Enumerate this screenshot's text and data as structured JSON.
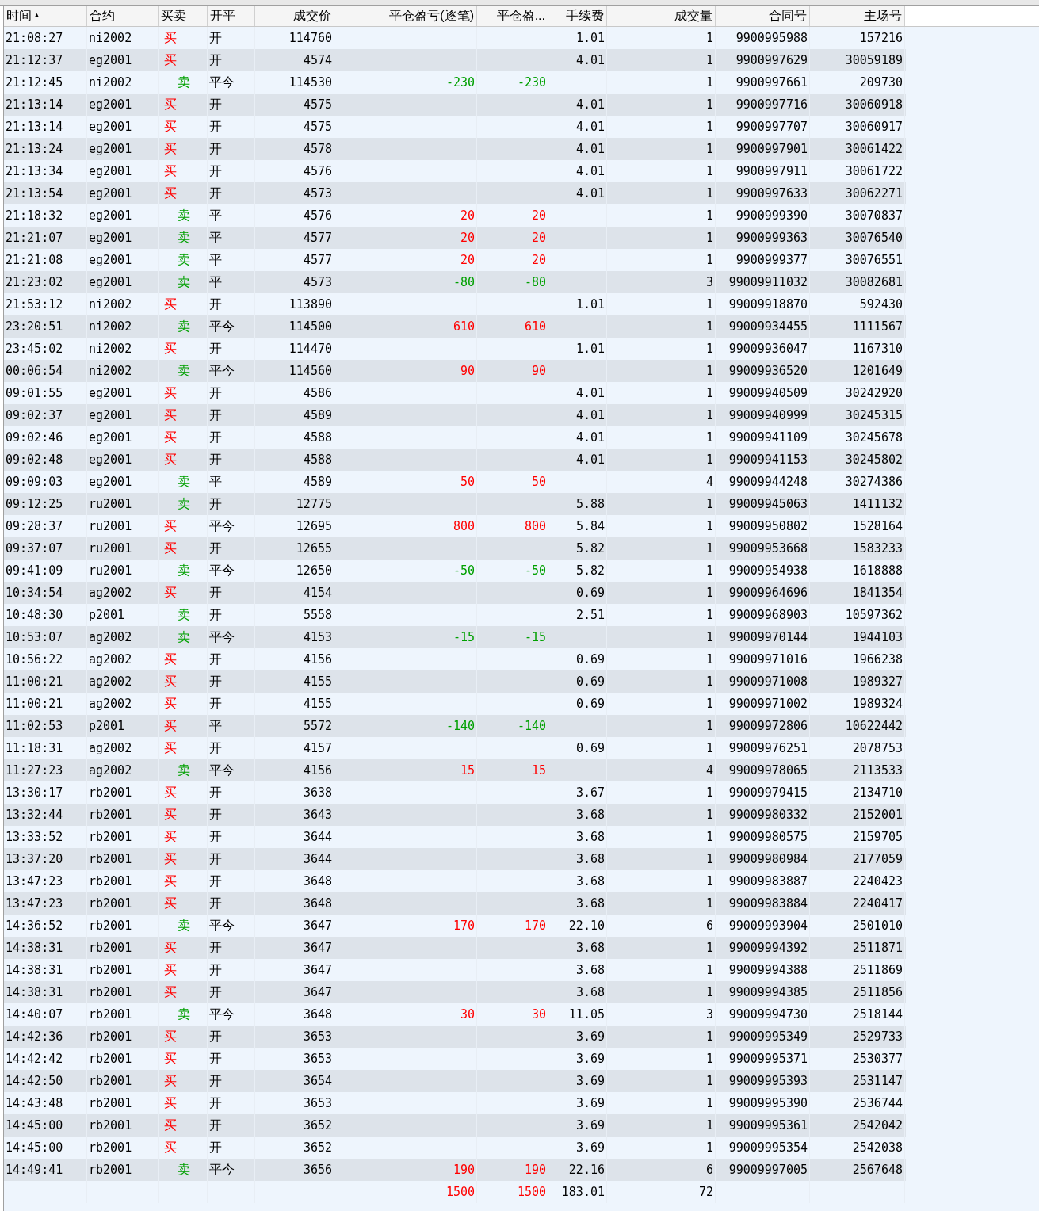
{
  "table": {
    "columns": [
      {
        "label": "时间",
        "sort_indicator": "▲"
      },
      {
        "label": "合约"
      },
      {
        "label": "买卖"
      },
      {
        "label": "开平"
      },
      {
        "label": "成交价"
      },
      {
        "label": "平仓盈亏(逐笔)"
      },
      {
        "label": "平仓盈..."
      },
      {
        "label": "手续费"
      },
      {
        "label": "成交量"
      },
      {
        "label": "合同号"
      },
      {
        "label": "主场号"
      }
    ],
    "rows": [
      {
        "kind": "buy",
        "cells": [
          "21:08:27",
          "ni2002",
          "买",
          "开",
          "114760",
          null,
          null,
          "1.01",
          "1",
          "9900995988",
          "157216"
        ]
      },
      {
        "kind": "buy",
        "cells": [
          "21:12:37",
          "eg2001",
          "买",
          "开",
          "4574",
          null,
          null,
          "4.01",
          "1",
          "9900997629",
          "30059189"
        ]
      },
      {
        "kind": "sell",
        "profit": false,
        "cells": [
          "21:12:45",
          "ni2002",
          "卖",
          "平今",
          "114530",
          "-230",
          "-230",
          null,
          "1",
          "9900997661",
          "209730"
        ]
      },
      {
        "kind": "buy",
        "cells": [
          "21:13:14",
          "eg2001",
          "买",
          "开",
          "4575",
          null,
          null,
          "4.01",
          "1",
          "9900997716",
          "30060918"
        ]
      },
      {
        "kind": "buy",
        "cells": [
          "21:13:14",
          "eg2001",
          "买",
          "开",
          "4575",
          null,
          null,
          "4.01",
          "1",
          "9900997707",
          "30060917"
        ]
      },
      {
        "kind": "buy",
        "cells": [
          "21:13:24",
          "eg2001",
          "买",
          "开",
          "4578",
          null,
          null,
          "4.01",
          "1",
          "9900997901",
          "30061422"
        ]
      },
      {
        "kind": "buy",
        "cells": [
          "21:13:34",
          "eg2001",
          "买",
          "开",
          "4576",
          null,
          null,
          "4.01",
          "1",
          "9900997911",
          "30061722"
        ]
      },
      {
        "kind": "buy",
        "cells": [
          "21:13:54",
          "eg2001",
          "买",
          "开",
          "4573",
          null,
          null,
          "4.01",
          "1",
          "9900997633",
          "30062271"
        ]
      },
      {
        "kind": "sell",
        "profit": true,
        "cells": [
          "21:18:32",
          "eg2001",
          "卖",
          "平",
          "4576",
          "20",
          "20",
          null,
          "1",
          "9900999390",
          "30070837"
        ]
      },
      {
        "kind": "sell",
        "profit": true,
        "cells": [
          "21:21:07",
          "eg2001",
          "卖",
          "平",
          "4577",
          "20",
          "20",
          null,
          "1",
          "9900999363",
          "30076540"
        ]
      },
      {
        "kind": "sell",
        "profit": true,
        "cells": [
          "21:21:08",
          "eg2001",
          "卖",
          "平",
          "4577",
          "20",
          "20",
          null,
          "1",
          "9900999377",
          "30076551"
        ]
      },
      {
        "kind": "sell",
        "profit": false,
        "cells": [
          "21:23:02",
          "eg2001",
          "卖",
          "平",
          "4573",
          "-80",
          "-80",
          null,
          "3",
          "99009911032",
          "30082681"
        ]
      },
      {
        "kind": "buy",
        "cells": [
          "21:53:12",
          "ni2002",
          "买",
          "开",
          "113890",
          null,
          null,
          "1.01",
          "1",
          "99009918870",
          "592430"
        ]
      },
      {
        "kind": "sell",
        "profit": true,
        "cells": [
          "23:20:51",
          "ni2002",
          "卖",
          "平今",
          "114500",
          "610",
          "610",
          null,
          "1",
          "99009934455",
          "1111567"
        ]
      },
      {
        "kind": "buy",
        "cells": [
          "23:45:02",
          "ni2002",
          "买",
          "开",
          "114470",
          null,
          null,
          "1.01",
          "1",
          "99009936047",
          "1167310"
        ]
      },
      {
        "kind": "sell",
        "profit": true,
        "cells": [
          "00:06:54",
          "ni2002",
          "卖",
          "平今",
          "114560",
          "90",
          "90",
          null,
          "1",
          "99009936520",
          "1201649"
        ]
      },
      {
        "kind": "buy",
        "cells": [
          "09:01:55",
          "eg2001",
          "买",
          "开",
          "4586",
          null,
          null,
          "4.01",
          "1",
          "99009940509",
          "30242920"
        ]
      },
      {
        "kind": "buy",
        "cells": [
          "09:02:37",
          "eg2001",
          "买",
          "开",
          "4589",
          null,
          null,
          "4.01",
          "1",
          "99009940999",
          "30245315"
        ]
      },
      {
        "kind": "buy",
        "cells": [
          "09:02:46",
          "eg2001",
          "买",
          "开",
          "4588",
          null,
          null,
          "4.01",
          "1",
          "99009941109",
          "30245678"
        ]
      },
      {
        "kind": "buy",
        "cells": [
          "09:02:48",
          "eg2001",
          "买",
          "开",
          "4588",
          null,
          null,
          "4.01",
          "1",
          "99009941153",
          "30245802"
        ]
      },
      {
        "kind": "sell",
        "profit": true,
        "cells": [
          "09:09:03",
          "eg2001",
          "卖",
          "平",
          "4589",
          "50",
          "50",
          null,
          "4",
          "99009944248",
          "30274386"
        ]
      },
      {
        "kind": "sell",
        "cells": [
          "09:12:25",
          "ru2001",
          "卖",
          "开",
          "12775",
          null,
          null,
          "5.88",
          "1",
          "99009945063",
          "1411132"
        ]
      },
      {
        "kind": "buy",
        "profit": true,
        "cells": [
          "09:28:37",
          "ru2001",
          "买",
          "平今",
          "12695",
          "800",
          "800",
          "5.84",
          "1",
          "99009950802",
          "1528164"
        ]
      },
      {
        "kind": "buy",
        "cells": [
          "09:37:07",
          "ru2001",
          "买",
          "开",
          "12655",
          null,
          null,
          "5.82",
          "1",
          "99009953668",
          "1583233"
        ]
      },
      {
        "kind": "sell",
        "profit": false,
        "cells": [
          "09:41:09",
          "ru2001",
          "卖",
          "平今",
          "12650",
          "-50",
          "-50",
          "5.82",
          "1",
          "99009954938",
          "1618888"
        ]
      },
      {
        "kind": "buy",
        "cells": [
          "10:34:54",
          "ag2002",
          "买",
          "开",
          "4154",
          null,
          null,
          "0.69",
          "1",
          "99009964696",
          "1841354"
        ]
      },
      {
        "kind": "sell",
        "cells": [
          "10:48:30",
          "p2001",
          "卖",
          "开",
          "5558",
          null,
          null,
          "2.51",
          "1",
          "99009968903",
          "10597362"
        ]
      },
      {
        "kind": "sell",
        "profit": false,
        "cells": [
          "10:53:07",
          "ag2002",
          "卖",
          "平今",
          "4153",
          "-15",
          "-15",
          null,
          "1",
          "99009970144",
          "1944103"
        ]
      },
      {
        "kind": "buy",
        "cells": [
          "10:56:22",
          "ag2002",
          "买",
          "开",
          "4156",
          null,
          null,
          "0.69",
          "1",
          "99009971016",
          "1966238"
        ]
      },
      {
        "kind": "buy",
        "cells": [
          "11:00:21",
          "ag2002",
          "买",
          "开",
          "4155",
          null,
          null,
          "0.69",
          "1",
          "99009971008",
          "1989327"
        ]
      },
      {
        "kind": "buy",
        "cells": [
          "11:00:21",
          "ag2002",
          "买",
          "开",
          "4155",
          null,
          null,
          "0.69",
          "1",
          "99009971002",
          "1989324"
        ]
      },
      {
        "kind": "buy",
        "profit": false,
        "cells": [
          "11:02:53",
          "p2001",
          "买",
          "平",
          "5572",
          "-140",
          "-140",
          null,
          "1",
          "99009972806",
          "10622442"
        ]
      },
      {
        "kind": "buy",
        "cells": [
          "11:18:31",
          "ag2002",
          "买",
          "开",
          "4157",
          null,
          null,
          "0.69",
          "1",
          "99009976251",
          "2078753"
        ]
      },
      {
        "kind": "sell",
        "profit": true,
        "cells": [
          "11:27:23",
          "ag2002",
          "卖",
          "平今",
          "4156",
          "15",
          "15",
          null,
          "4",
          "99009978065",
          "2113533"
        ]
      },
      {
        "kind": "buy",
        "cells": [
          "13:30:17",
          "rb2001",
          "买",
          "开",
          "3638",
          null,
          null,
          "3.67",
          "1",
          "99009979415",
          "2134710"
        ]
      },
      {
        "kind": "buy",
        "cells": [
          "13:32:44",
          "rb2001",
          "买",
          "开",
          "3643",
          null,
          null,
          "3.68",
          "1",
          "99009980332",
          "2152001"
        ]
      },
      {
        "kind": "buy",
        "cells": [
          "13:33:52",
          "rb2001",
          "买",
          "开",
          "3644",
          null,
          null,
          "3.68",
          "1",
          "99009980575",
          "2159705"
        ]
      },
      {
        "kind": "buy",
        "cells": [
          "13:37:20",
          "rb2001",
          "买",
          "开",
          "3644",
          null,
          null,
          "3.68",
          "1",
          "99009980984",
          "2177059"
        ]
      },
      {
        "kind": "buy",
        "cells": [
          "13:47:23",
          "rb2001",
          "买",
          "开",
          "3648",
          null,
          null,
          "3.68",
          "1",
          "99009983887",
          "2240423"
        ]
      },
      {
        "kind": "buy",
        "cells": [
          "13:47:23",
          "rb2001",
          "买",
          "开",
          "3648",
          null,
          null,
          "3.68",
          "1",
          "99009983884",
          "2240417"
        ]
      },
      {
        "kind": "sell",
        "profit": true,
        "cells": [
          "14:36:52",
          "rb2001",
          "卖",
          "平今",
          "3647",
          "170",
          "170",
          "22.10",
          "6",
          "99009993904",
          "2501010"
        ]
      },
      {
        "kind": "buy",
        "cells": [
          "14:38:31",
          "rb2001",
          "买",
          "开",
          "3647",
          null,
          null,
          "3.68",
          "1",
          "99009994392",
          "2511871"
        ]
      },
      {
        "kind": "buy",
        "cells": [
          "14:38:31",
          "rb2001",
          "买",
          "开",
          "3647",
          null,
          null,
          "3.68",
          "1",
          "99009994388",
          "2511869"
        ]
      },
      {
        "kind": "buy",
        "cells": [
          "14:38:31",
          "rb2001",
          "买",
          "开",
          "3647",
          null,
          null,
          "3.68",
          "1",
          "99009994385",
          "2511856"
        ]
      },
      {
        "kind": "sell",
        "profit": true,
        "cells": [
          "14:40:07",
          "rb2001",
          "卖",
          "平今",
          "3648",
          "30",
          "30",
          "11.05",
          "3",
          "99009994730",
          "2518144"
        ]
      },
      {
        "kind": "buy",
        "cells": [
          "14:42:36",
          "rb2001",
          "买",
          "开",
          "3653",
          null,
          null,
          "3.69",
          "1",
          "99009995349",
          "2529733"
        ]
      },
      {
        "kind": "buy",
        "cells": [
          "14:42:42",
          "rb2001",
          "买",
          "开",
          "3653",
          null,
          null,
          "3.69",
          "1",
          "99009995371",
          "2530377"
        ]
      },
      {
        "kind": "buy",
        "cells": [
          "14:42:50",
          "rb2001",
          "买",
          "开",
          "3654",
          null,
          null,
          "3.69",
          "1",
          "99009995393",
          "2531147"
        ]
      },
      {
        "kind": "buy",
        "cells": [
          "14:43:48",
          "rb2001",
          "买",
          "开",
          "3653",
          null,
          null,
          "3.69",
          "1",
          "99009995390",
          "2536744"
        ]
      },
      {
        "kind": "buy",
        "cells": [
          "14:45:00",
          "rb2001",
          "买",
          "开",
          "3652",
          null,
          null,
          "3.69",
          "1",
          "99009995361",
          "2542042"
        ]
      },
      {
        "kind": "buy",
        "cells": [
          "14:45:00",
          "rb2001",
          "买",
          "开",
          "3652",
          null,
          null,
          "3.69",
          "1",
          "99009995354",
          "2542038"
        ]
      },
      {
        "kind": "sell",
        "profit": true,
        "cells": [
          "14:49:41",
          "rb2001",
          "卖",
          "平今",
          "3656",
          "190",
          "190",
          "22.16",
          "6",
          "99009997005",
          "2567648"
        ]
      }
    ],
    "totals": {
      "profit": true,
      "cells": [
        null,
        null,
        null,
        null,
        null,
        "1500",
        "1500",
        "183.01",
        "72",
        null,
        null
      ]
    }
  }
}
